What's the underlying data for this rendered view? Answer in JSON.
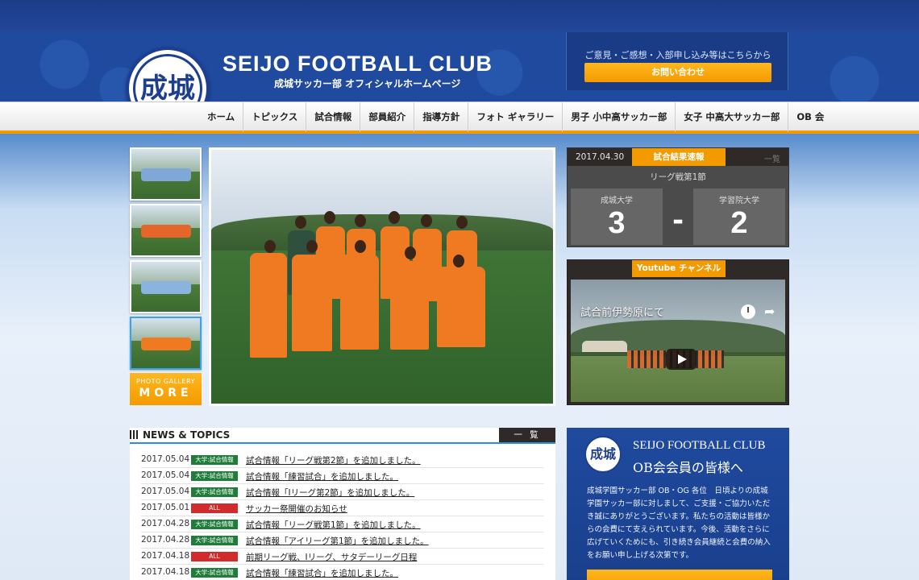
{
  "header": {
    "logo_text": "成城",
    "title": "SEIJO FOOTBALL CLUB",
    "subtitle": "成城サッカー部 オフィシャルホームページ",
    "contact_text": "ご意見・ご感想・入部申し込み等はこちらから",
    "contact_button": "お問い合わせ"
  },
  "nav": {
    "items": [
      {
        "label": "ホーム"
      },
      {
        "label": "トピックス"
      },
      {
        "label": "試合情報"
      },
      {
        "label": "部員紹介"
      },
      {
        "label": "指導方針"
      },
      {
        "label": "フォト ギャラリー"
      },
      {
        "label": "男子 小中高サッカー部"
      },
      {
        "label": "女子 中高大サッカー部"
      },
      {
        "label": "OB 会"
      }
    ]
  },
  "gallery": {
    "more_small": "PHOTO GALLERY",
    "more_big": "MORE"
  },
  "result": {
    "date": "2017.04.30",
    "tag": "試合結果速報",
    "list_label": "一覧",
    "league": "リーグ戦第1節",
    "home_team": "成城大学",
    "away_team": "学習院大学",
    "home_score": "3",
    "away_score": "2",
    "separator": "-"
  },
  "youtube": {
    "tag": "Youtube チャンネル",
    "video_title": "試合前伊勢原にて",
    "share_icon": "share-icon",
    "clock_icon": "watch-later-icon"
  },
  "news": {
    "title": "NEWS & TOPICS",
    "list_button": "一 覧",
    "items": [
      {
        "date": "2017.05.04",
        "badge": "大学:試合情報",
        "badge_color": "#1f7d3a",
        "text": "試合情報「リーグ戦第2節」を追加しました。"
      },
      {
        "date": "2017.05.04",
        "badge": "大学:試合情報",
        "badge_color": "#1f7d3a",
        "text": "試合情報「練習試合」を追加しました。"
      },
      {
        "date": "2017.05.04",
        "badge": "大学:試合情報",
        "badge_color": "#1f7d3a",
        "text": "試合情報「Iリーグ第2節」を追加しました。"
      },
      {
        "date": "2017.05.01",
        "badge": "ALL",
        "badge_color": "#d22b2b",
        "text": "サッカー祭開催のお知らせ"
      },
      {
        "date": "2017.04.28",
        "badge": "大学:試合情報",
        "badge_color": "#1f7d3a",
        "text": "試合情報「リーグ戦第1節」を追加しました。"
      },
      {
        "date": "2017.04.28",
        "badge": "大学:試合情報",
        "badge_color": "#1f7d3a",
        "text": "試合情報「アイリーグ第1節」を追加しました。"
      },
      {
        "date": "2017.04.18",
        "badge": "ALL",
        "badge_color": "#d22b2b",
        "text": "前期リーグ戦、Iリーグ、サタデーリーグ日程"
      },
      {
        "date": "2017.04.18",
        "badge": "大学:試合情報",
        "badge_color": "#1f7d3a",
        "text": "試合情報「練習試合」を追加しました。"
      }
    ]
  },
  "ob": {
    "logo_text": "成城",
    "title_en": "SEIJO FOOTBALL CLUB",
    "title_ja": "OB会会員の皆様へ",
    "body": "成城学園サッカー部 OB・OG 各位　日頃よりの成城学園サッカー部に対しまして、ご支援・ご協力いただき誠にありがとうございます。私たちの活動は皆様からの会費にて支えられています。今後、活動をさらに広げていくためにも、引き続き会員継続と会費の納入をお願い申し上げる次第です。"
  },
  "colors": {
    "brand_blue": "#1f4a9e",
    "accent_orange": "#f39a00",
    "news_line": "#2d8fd9"
  }
}
